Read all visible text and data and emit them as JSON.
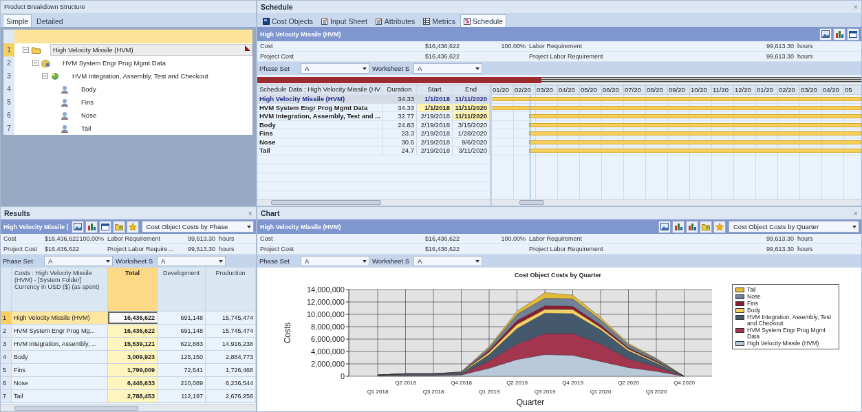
{
  "pbs": {
    "title": "Product Breakdown Structure",
    "tabs": [
      {
        "label": "Simple",
        "selected": true
      },
      {
        "label": "Detailed",
        "selected": false
      }
    ],
    "tree": [
      {
        "num": "1",
        "label": "High Velocity Missile (HVM)",
        "kind": "folder",
        "expanded": true,
        "selected": true,
        "flagged": true,
        "children": [
          {
            "num": "2",
            "label": "HVM System Engr Prog Mgmt Data",
            "kind": "package",
            "expanded": true,
            "selected": false,
            "flagged": false,
            "children": [
              {
                "num": "3",
                "label": "HVM Integration, Assembly, Test and Checkout",
                "kind": "sphere",
                "expanded": true,
                "selected": false,
                "flagged": false,
                "children": [
                  {
                    "num": "4",
                    "label": "Body",
                    "kind": "person",
                    "selected": false,
                    "flagged": false
                  },
                  {
                    "num": "5",
                    "label": "Fins",
                    "kind": "person",
                    "selected": false,
                    "flagged": false
                  },
                  {
                    "num": "6",
                    "label": "Nose",
                    "kind": "person",
                    "selected": false,
                    "flagged": false
                  },
                  {
                    "num": "7",
                    "label": "Tail",
                    "kind": "person",
                    "selected": false,
                    "flagged": false
                  }
                ]
              }
            ]
          }
        ]
      }
    ]
  },
  "schedule": {
    "title": "Schedule",
    "close": "×",
    "tabs": [
      {
        "label": "Cost Objects",
        "kind": "cube",
        "selected": false
      },
      {
        "label": "Input Sheet",
        "kind": "sheet",
        "selected": false
      },
      {
        "label": "Attributes",
        "kind": "sheet",
        "selected": false
      },
      {
        "label": "Metrics",
        "kind": "grid",
        "selected": false
      },
      {
        "label": "Schedule",
        "kind": "gantt",
        "selected": true
      }
    ],
    "info": {
      "title": "High Velocity Missile (HVM)",
      "tools": [
        {
          "kind": "image"
        },
        {
          "kind": "chart"
        },
        {
          "kind": "calendar"
        }
      ],
      "rows": [
        {
          "label": "Cost",
          "value": "$16,436,622",
          "percent": "100.00%",
          "label2": "Labor Requirement",
          "value2": "99,613.30",
          "unit": "hours"
        },
        {
          "label": "Project Cost",
          "value": "$16,436,622",
          "label2": "Project Labor Requirement",
          "value2": "99,613.30",
          "unit": "hours"
        }
      ],
      "phase": {
        "label": "Phase Set",
        "value": "A",
        "worksheet_label": "Worksheet S",
        "worksheet_value": "A"
      }
    },
    "overview": {
      "level": 0.47
    },
    "gantt": {
      "columns": [
        "Schedule Data : High Velocity Missile (HV",
        "Duration",
        "Start",
        "End"
      ],
      "months": [
        "01/20",
        "02/20",
        "03/20",
        "04/20",
        "05/20",
        "06/20",
        "07/20",
        "08/20",
        "09/20",
        "10/20",
        "11/20",
        "12/20",
        "01/20",
        "02/20",
        "03/20",
        "04/20",
        "05"
      ],
      "rows": [
        {
          "name": "High Velocity Missile (HVM)",
          "duration": "34.33",
          "start": "1/1/2018",
          "end": "11/11/2020",
          "selected": true,
          "start_highlighted": false,
          "end_highlighted": false,
          "kind": "early"
        },
        {
          "name": "HVM System Engr Prog Mgmt Data",
          "duration": "34.33",
          "start": "1/1/2018",
          "end": "11/11/2020",
          "selected": false,
          "start_highlighted": true,
          "end_highlighted": true,
          "kind": "early"
        },
        {
          "name": "HVM Integration, Assembly, Test and ...",
          "duration": "32.77",
          "start": "2/19/2018",
          "end": "11/11/2020",
          "selected": false,
          "start_highlighted": false,
          "end_highlighted": true,
          "kind": "late"
        },
        {
          "name": "Body",
          "duration": "24.83",
          "start": "2/19/2018",
          "end": "3/15/2020",
          "selected": false,
          "start_highlighted": false,
          "end_highlighted": false,
          "kind": "late"
        },
        {
          "name": "Fins",
          "duration": "23.3",
          "start": "2/19/2018",
          "end": "1/28/2020",
          "selected": false,
          "start_highlighted": false,
          "end_highlighted": false,
          "kind": "late"
        },
        {
          "name": "Nose",
          "duration": "30.6",
          "start": "2/19/2018",
          "end": "9/6/2020",
          "selected": false,
          "start_highlighted": false,
          "end_highlighted": false,
          "kind": "late"
        },
        {
          "name": "Tail",
          "duration": "24.7",
          "start": "2/19/2018",
          "end": "3/11/2020",
          "selected": false,
          "start_highlighted": false,
          "end_highlighted": false,
          "kind": "late"
        }
      ]
    }
  },
  "results": {
    "title": "Results",
    "close": "×",
    "info": {
      "title": "High Velocity Missile (",
      "tools": [
        {
          "kind": "image"
        },
        {
          "kind": "chart"
        },
        {
          "kind": "calendar"
        },
        {
          "kind": "folder"
        },
        {
          "kind": "star"
        }
      ],
      "report": "Cost Object Costs by Phase",
      "rows": [
        {
          "label": "Cost",
          "value": "$16,436,622",
          "percent": "100.00%",
          "label2": "Labor Requirement",
          "value2": "99,613.30",
          "unit": "hours"
        },
        {
          "label": "Project Cost",
          "value": "$16,436,622",
          "label2": "Project Labor Require…",
          "value2": "99,613.30",
          "unit": "hours"
        }
      ],
      "phase": {
        "label": "Phase Set",
        "value": "A",
        "worksheet_label": "Worksheet S",
        "worksheet_value": "A"
      }
    },
    "table": {
      "columns": [
        "Costs : High Velocity Missile (HVM) - [System Folder] Currency in USD ($) (as spent)",
        "Total",
        "Development",
        "Production"
      ],
      "rows": [
        {
          "num": "1",
          "name": "High Velocity Missile (HVM)",
          "total": "16,436,622",
          "development": "691,148",
          "production": "15,745,474",
          "selected": true
        },
        {
          "num": "2",
          "name": "HVM System Engr Prog Mg...",
          "total": "16,436,622",
          "development": "691,148",
          "production": "15,745,474",
          "selected": false
        },
        {
          "num": "3",
          "name": "HVM Integration, Assembly, ...",
          "total": "15,539,121",
          "development": "622,883",
          "production": "14,916,238",
          "selected": false
        },
        {
          "num": "4",
          "name": "Body",
          "total": "3,009,923",
          "development": "125,150",
          "production": "2,884,773",
          "selected": false
        },
        {
          "num": "5",
          "name": "Fins",
          "total": "1,799,009",
          "development": "72,541",
          "production": "1,726,468",
          "selected": false
        },
        {
          "num": "6",
          "name": "Nose",
          "total": "6,446,633",
          "development": "210,089",
          "production": "6,236,544",
          "selected": false
        },
        {
          "num": "7",
          "name": "Tail",
          "total": "2,788,453",
          "development": "112,197",
          "production": "2,676,256",
          "selected": false
        }
      ]
    }
  },
  "chart": {
    "title": "Chart",
    "close": "×",
    "info": {
      "title": "High Velocity Missile (HVM)",
      "tools": [
        {
          "kind": "image"
        },
        {
          "kind": "chart"
        },
        {
          "kind": "chart"
        },
        {
          "kind": "folder"
        },
        {
          "kind": "star"
        }
      ],
      "report": "Cost Object Costs by Quarter",
      "rows": [
        {
          "label": "Cost",
          "value": "$16,436,622",
          "percent": "100.00%",
          "label2": "Labor Requirement",
          "value2": "99,613.30",
          "unit": "hours"
        },
        {
          "label": "Project Cost",
          "value": "$16,436,622",
          "label2": "Project Labor Requirement",
          "value2": "99,613.30",
          "unit": "hours"
        }
      ],
      "phase": {
        "label": "Phase Set",
        "value": "A",
        "worksheet_label": "Worksheet S",
        "worksheet_value": "A"
      }
    },
    "chart_data": {
      "type": "area",
      "stacked": true,
      "title": "Cost Object Costs by Quarter",
      "xlabel": "Quarter",
      "ylabel": "Costs",
      "categories": [
        "Q1 2018",
        "Q2 2018",
        "Q3 2018",
        "Q4 2018",
        "Q1 2019",
        "Q2 2019",
        "Q3 2019",
        "Q4 2019",
        "Q1 2020",
        "Q2 2020",
        "Q3 2020",
        "Q4 2020"
      ],
      "ylim": [
        0,
        14000000
      ],
      "grid": true,
      "legend": true,
      "yticks": [
        {
          "value": 0,
          "label": "0"
        },
        {
          "value": 2000000,
          "label": "2,000,000"
        },
        {
          "value": 4000000,
          "label": "4,000,000"
        },
        {
          "value": 6000000,
          "label": "6,000,000"
        },
        {
          "value": 8000000,
          "label": "8,000,000"
        },
        {
          "value": 10000000,
          "label": "10,000,000"
        },
        {
          "value": 12000000,
          "label": "12,000,000"
        },
        {
          "value": 14000000,
          "label": "14,000,000"
        }
      ],
      "series": [
        {
          "name": "High Velocity Missile (HVM)",
          "color": "#b9c9d9",
          "values": [
            100000,
            100000,
            100000,
            200000,
            1300000,
            2700000,
            3500000,
            3400000,
            2400000,
            1400000,
            800000,
            0
          ]
        },
        {
          "name": "HVM System Engr Prog Mgmt Data",
          "color": "#a3354f",
          "values": [
            0,
            100000,
            100000,
            100000,
            1200000,
            2500000,
            3400000,
            3500000,
            2800000,
            1400000,
            700000,
            0
          ]
        },
        {
          "name": "HVM Integration, Assembly, Test and Checkout",
          "color": "#44596c",
          "values": [
            100000,
            200000,
            200000,
            200000,
            1000000,
            2500000,
            3300000,
            3200000,
            2300000,
            1300000,
            600000,
            0
          ]
        },
        {
          "name": "Body",
          "color": "#f2d264",
          "values": [
            0,
            0,
            0,
            100000,
            400000,
            700000,
            600000,
            700000,
            400000,
            300000,
            200000,
            0
          ]
        },
        {
          "name": "Fins",
          "color": "#8c1c32",
          "values": [
            0,
            0,
            0,
            0,
            300000,
            600000,
            600000,
            500000,
            400000,
            200000,
            200000,
            0
          ]
        },
        {
          "name": "Nose",
          "color": "#6e8298",
          "values": [
            0,
            0,
            0,
            100000,
            400000,
            1000000,
            1200000,
            1200000,
            800000,
            500000,
            300000,
            0
          ]
        },
        {
          "name": "Tail",
          "color": "#e3b93a",
          "values": [
            0,
            0,
            0,
            0,
            200000,
            500000,
            900000,
            600000,
            400000,
            200000,
            100000,
            0
          ]
        }
      ]
    }
  }
}
